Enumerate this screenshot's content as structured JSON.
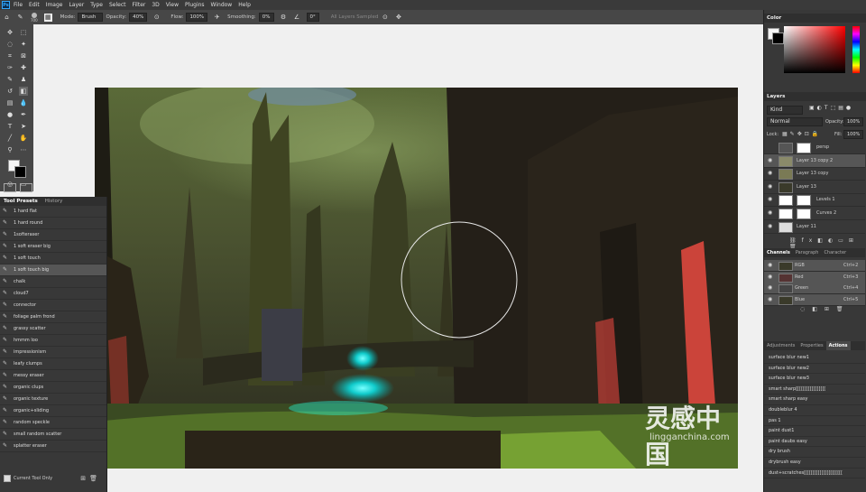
{
  "menu": {
    "app_icon": "Ps",
    "items": [
      "File",
      "Edit",
      "Image",
      "Layer",
      "Type",
      "Select",
      "Filter",
      "3D",
      "View",
      "Plugins",
      "Window",
      "Help"
    ]
  },
  "options": {
    "brush_size": "700",
    "mode_label": "Mode:",
    "mode_value": "Brush",
    "opacity_label": "Opacity:",
    "opacity_value": "40%",
    "flow_label": "Flow:",
    "flow_value": "100%",
    "smoothing_label": "Smoothing:",
    "smoothing_value": "0%",
    "angle_value": "0°",
    "all_layers_label": "All Layers Sampled"
  },
  "presets": {
    "tabs": [
      "Tool Presets",
      "History"
    ],
    "items": [
      "1 hard flat",
      "1 hard round",
      "1softeraser",
      "1 soft eraser big",
      "1 soft touch",
      "1 soft touch big",
      "chalk",
      "cloud7",
      "connector",
      "foliage palm frond",
      "grassy scatter",
      "hmmm loo",
      "impressionism",
      "leafy clumps",
      "messy eraser",
      "organic clups",
      "organic texture",
      "organic+sliding",
      "random speckle",
      "small random scatter",
      "splatter eraser"
    ],
    "selected_index": 5,
    "footer_label": "Current Tool Only"
  },
  "color_panel": {
    "title": "Color"
  },
  "layers_panel": {
    "title": "Layers",
    "kind_label": "Kind",
    "blend_mode": "Normal",
    "opacity_label": "Opacity:",
    "opacity_value": "100%",
    "lock_label": "Lock:",
    "fill_label": "Fill:",
    "fill_value": "100%",
    "layers": [
      "persp",
      "Layer 13 copy 2",
      "Layer 13 copy",
      "Layer 13",
      "Levels 1",
      "Curves 2",
      "Layer 11"
    ]
  },
  "channels_panel": {
    "tabs": [
      "Channels",
      "Paragraph",
      "Character"
    ],
    "channels": [
      {
        "name": "RGB",
        "shortcut": "Ctrl+2"
      },
      {
        "name": "Red",
        "shortcut": "Ctrl+3"
      },
      {
        "name": "Green",
        "shortcut": "Ctrl+4"
      },
      {
        "name": "Blue",
        "shortcut": "Ctrl+5"
      }
    ]
  },
  "actions_panel": {
    "tabs": [
      "Adjustments",
      "Properties",
      "Actions"
    ],
    "items": [
      "surface blur new1",
      "surface blur new2",
      "surface blur new3",
      "smart sharp[[[[[[[[[[[[[[[[[",
      "smart sharp easy",
      "doubleblur 4",
      "pas 1",
      "paint dust1",
      "paint daubs easy",
      "dry brush",
      "drybrush easy",
      "dust+scratches[[[[[[[[[[[[[[[[[[[[[["
    ]
  },
  "watermark": {
    "line1": "灵感中国",
    "line2": "lingganchina.com"
  },
  "colors": {
    "accent": "#31a8ff",
    "bg": "#383838",
    "canvas": "#f0f0f0"
  }
}
